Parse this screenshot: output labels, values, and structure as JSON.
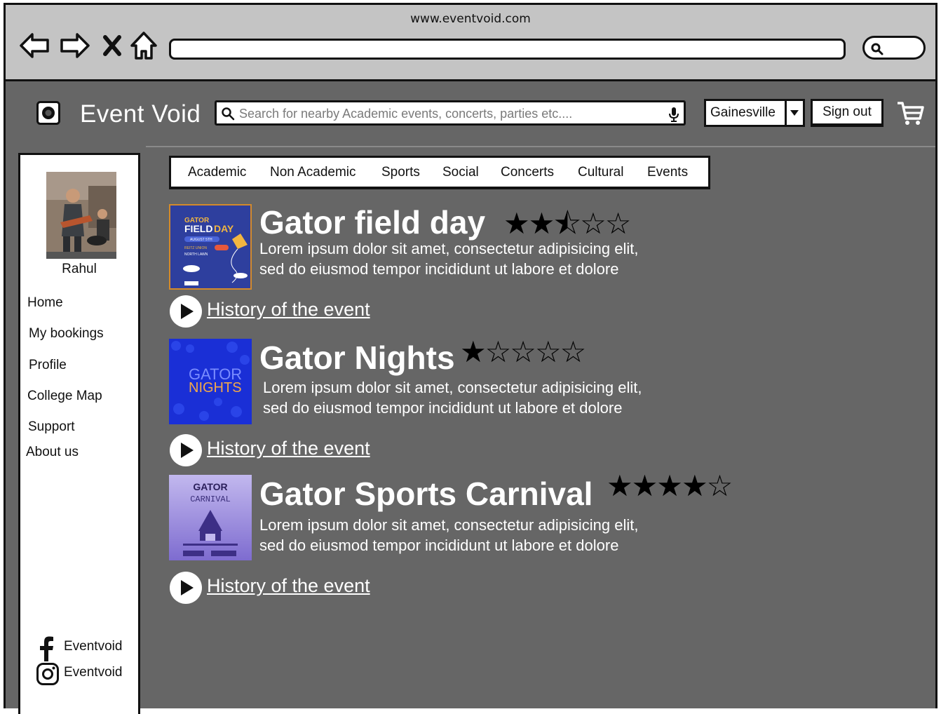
{
  "browser": {
    "url": "www.eventvoid.com"
  },
  "header": {
    "app_title": "Event Void",
    "search_placeholder": "Search for nearby Academic events, concerts, parties etc....",
    "location": "Gainesville",
    "signout_label": "Sign out"
  },
  "sidebar": {
    "username": "Rahul",
    "items": [
      {
        "label": "Home"
      },
      {
        "label": "My bookings"
      },
      {
        "label": "Profile"
      },
      {
        "label": "College Map"
      },
      {
        "label": "Support"
      },
      {
        "label": "About us"
      }
    ],
    "social": [
      {
        "icon": "facebook-icon",
        "label": "Eventvoid"
      },
      {
        "icon": "instagram-icon",
        "label": "Eventvoid"
      }
    ]
  },
  "categories": [
    "Academic",
    "Non Academic",
    "Sports",
    "Social",
    "Concerts",
    "Cultural",
    "Events"
  ],
  "events": [
    {
      "title": "Gator field day",
      "rating": 2.5,
      "stars": "★★⯪☆☆",
      "desc_line1": "Lorem ipsum dolor sit amet, consectetur adipisicing elit,",
      "desc_line2": "sed do eiusmod tempor incididunt ut labore et dolore",
      "history_label": "History of the event",
      "thumb": {
        "line1": "GATOR",
        "line2": "FIELD",
        "line3": "DAY",
        "line4": "AUGUST 5TH",
        "line5": "REITZ UNION",
        "line6": "NORTH LAWN"
      }
    },
    {
      "title": "Gator Nights",
      "rating": 1,
      "stars": "★☆☆☆☆",
      "desc_line1": "Lorem ipsum dolor sit amet, consectetur adipisicing elit,",
      "desc_line2": "sed do eiusmod tempor incididunt ut labore et dolore",
      "history_label": "History of the event",
      "thumb": {
        "line1": "GATOR",
        "line2": "NIGHTS"
      }
    },
    {
      "title": "Gator Sports Carnival",
      "rating": 4,
      "stars": "★★★★☆",
      "desc_line1": "Lorem ipsum dolor sit amet, consectetur adipisicing elit,",
      "desc_line2": "sed do eiusmod tempor incididunt ut labore et dolore",
      "history_label": "History of the event",
      "thumb": {
        "line1": "GATOR",
        "line2": "CARNIVAL"
      }
    }
  ],
  "colors": {
    "page_bg": "#666666",
    "chrome_bg": "#c4c4c4",
    "thumb_field_day": "#2e3f9e",
    "thumb_nights": "#1a2fd6",
    "thumb_carnival": "#a79ae0"
  }
}
